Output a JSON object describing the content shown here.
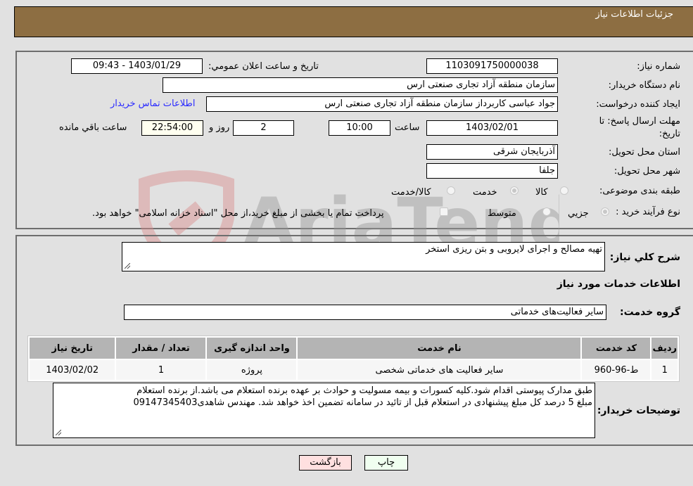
{
  "header": {
    "title": "جزئیات اطلاعات نیاز"
  },
  "fields": {
    "need_number_label": "شماره نیاز:",
    "need_number": "1103091750000038",
    "announce_label": "تاریخ و ساعت اعلان عمومي:",
    "announce_value": "1403/01/29 - 09:43",
    "buyer_org_label": "نام دستگاه خریدار:",
    "buyer_org": "سازمان منطقه آزاد تجاری صنعتی ارس",
    "creator_label": "ایجاد کننده درخواست:",
    "creator": "جواد عباسی کاربرداز سازمان منطقه آزاد تجاری صنعتی ارس",
    "contact_link": "اطلاعات تماس خریدار",
    "deadline_label_1": "مهلت ارسال پاسخ: تا",
    "deadline_label_2": "تاریخ:",
    "deadline_date": "1403/02/01",
    "time_label": "ساعت",
    "deadline_time": "10:00",
    "days_value": "2",
    "days_label": "روز و",
    "remaining_time": "22:54:00",
    "remaining_label": "ساعت باقي مانده",
    "province_label": "استان محل تحویل:",
    "province": "آذربایجان شرقی",
    "city_label": "شهر محل تحویل:",
    "city": "جلفا",
    "category_label": "طبقه بندی موضوعی:",
    "category_options": [
      {
        "label": "کالا",
        "checked": false
      },
      {
        "label": "خدمت",
        "checked": true
      },
      {
        "label": "کالا/خدمت",
        "checked": false
      }
    ],
    "process_label": "نوع فرآیند خرید :",
    "process_options": [
      {
        "label": "جزيي",
        "checked": true
      },
      {
        "label": "متوسط",
        "checked": false
      }
    ],
    "treasury_note": "پرداخت تمام یا بخشی از مبلغ خرید،از محل \"اسناد خزانه اسلامی\" خواهد بود."
  },
  "description": {
    "label": "شرح كلي نياز:",
    "value": "تهیه مصالح و اجرای لایروبی و بتن ریزی استخر"
  },
  "services": {
    "section_title": "اطلاعات خدمات مورد نیاز",
    "group_label": "گروه خدمت:",
    "group_value": "سایر فعالیت‌های خدماتی",
    "columns": [
      "ردیف",
      "کد خدمت",
      "نام خدمت",
      "واحد اندازه گیری",
      "تعداد / مقدار",
      "تاریخ نیاز"
    ],
    "rows": [
      [
        "1",
        "ط-96-960",
        "سایر فعالیت های خدماتی شخصی",
        "پروژه",
        "1",
        "1403/02/02"
      ]
    ]
  },
  "buyer_notes": {
    "label": "توضیحات خریدار:",
    "line1": "طبق مدارک پیوستی اقدام شود.کلیه کسورات و بیمه مسولیت و حوادث بر عهده برنده استعلام می باشد.از برنده استعلام",
    "line2": "مبلغ 5 درصد کل مبلغ پیشنهادی در استعلام قبل از تائید در سامانه تضمین اخذ خواهد شد. مهندس شاهدی09147345403"
  },
  "buttons": {
    "print": "چاپ",
    "back": "بازگشت"
  },
  "watermark": {
    "text": "AriaTender.neT"
  },
  "colors": {
    "header_bg": "#8d6e42",
    "link": "#2a2aff",
    "back_btn": "#ffe0e0",
    "print_btn": "#f0fff0"
  }
}
